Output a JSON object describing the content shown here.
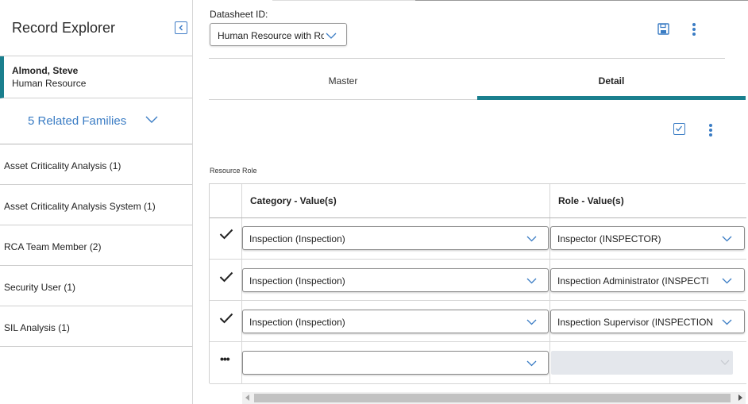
{
  "explorer": {
    "title": "Record Explorer",
    "record": {
      "name": "Almond, Steve",
      "family": "Human Resource"
    },
    "related_label": "5 Related Families",
    "families": [
      "Asset Criticality Analysis (1)",
      "Asset Criticality Analysis System (1)",
      "RCA Team Member (2)",
      "Security User (1)",
      "SIL Analysis (1)"
    ]
  },
  "datasheet": {
    "label": "Datasheet ID:",
    "value": "Human Resource with Role"
  },
  "tabs": {
    "master": "Master",
    "detail": "Detail"
  },
  "section": {
    "label": "Resource Role",
    "columns": {
      "category": "Category - Value(s)",
      "role": "Role - Value(s)"
    },
    "rows": [
      {
        "category": "Inspection (Inspection)",
        "role": "Inspector (INSPECTOR)"
      },
      {
        "category": "Inspection (Inspection)",
        "role": "Inspection Administrator (INSPECTION ADMINISTRATOR)"
      },
      {
        "category": "Inspection (Inspection)",
        "role": "Inspection Supervisor (INSPECTION SUPERVISOR)"
      }
    ],
    "new_row_marker": "•••"
  },
  "colors": {
    "accent": "#1a7f8e",
    "link": "#3a7cc4"
  }
}
